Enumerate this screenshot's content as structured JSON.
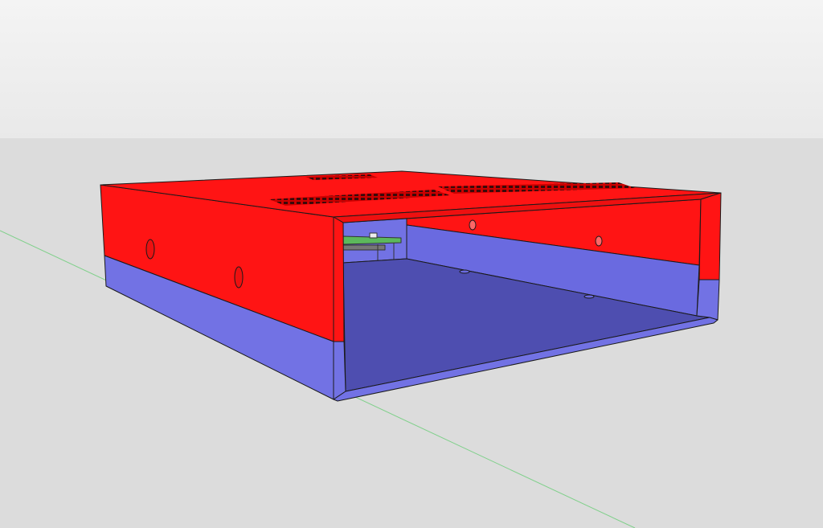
{
  "viewport": {
    "colors": {
      "sky_top": "#f4f4f4",
      "sky_bottom": "#e9e9e9",
      "ground": "#dcdcdc",
      "axis_green": "#7fd08a",
      "case_red": "#ff1414",
      "case_red_shade": "#e00f0f",
      "case_blue": "#7272e4",
      "floor_blue": "#4e4eb0",
      "edge": "#1a1a1a",
      "pcb_green": "#5cb85c"
    }
  }
}
